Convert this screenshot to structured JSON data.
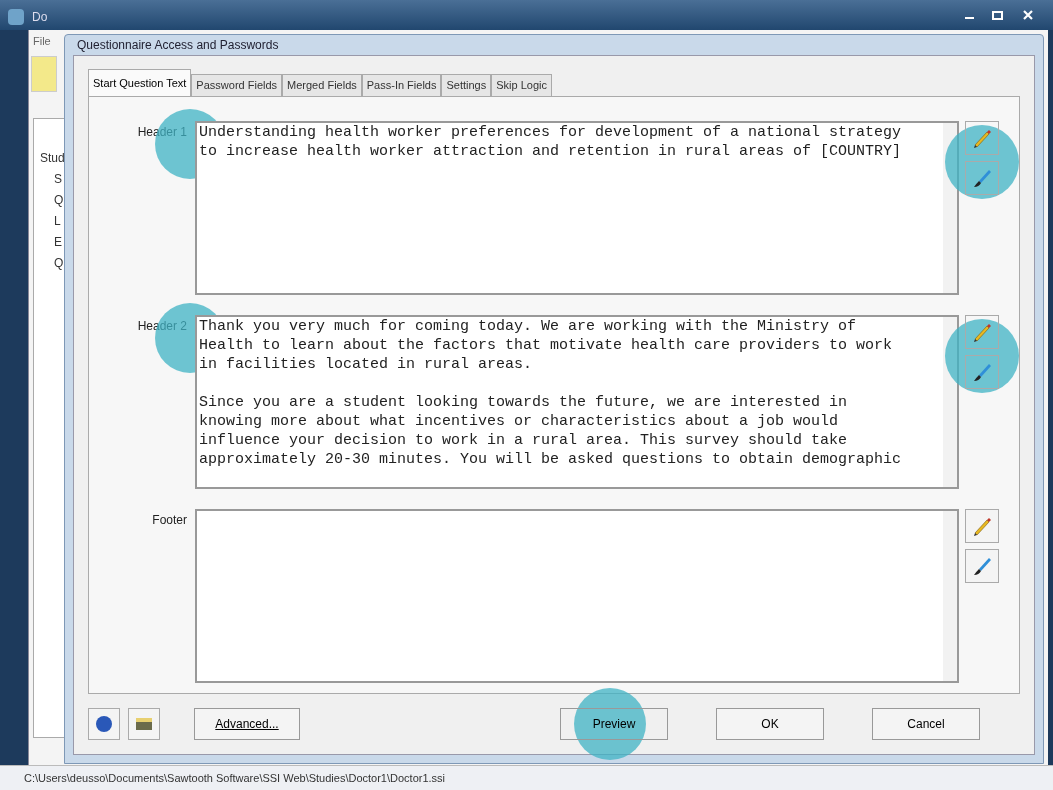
{
  "main_window": {
    "title": "Do",
    "menu": [
      "File"
    ],
    "tree": [
      "Stud",
      "S",
      "Q",
      "L",
      "E",
      "Q"
    ],
    "status_bar": "C:\\Users\\deusso\\Documents\\Sawtooth Software\\SSI Web\\Studies\\Doctor1\\Doctor1.ssi"
  },
  "dialog": {
    "title": "Questionnaire Access and Passwords",
    "tabs": [
      {
        "label": "Start Question Text",
        "selected": true
      },
      {
        "label": "Password Fields",
        "selected": false
      },
      {
        "label": "Merged Fields",
        "selected": false
      },
      {
        "label": "Pass-In Fields",
        "selected": false
      },
      {
        "label": "Settings",
        "selected": false
      },
      {
        "label": "Skip Logic",
        "selected": false
      }
    ],
    "fields": [
      {
        "label": "Header 1",
        "value": "Understanding health worker preferences for development of a national strategy\nto increase health worker attraction and retention in rural areas of [COUNTRY]",
        "highlighted": true
      },
      {
        "label": "Header 2",
        "value": "Thank you very much for coming today. We are working with the Ministry of\nHealth to learn about the factors that motivate health care providers to work\nin facilities located in rural areas.\n\nSince you are a student looking towards the future, we are interested in\nknowing more about what incentives or characteristics about a job would\ninfluence your decision to work in a rural area. This survey should take\napproximately 20-30 minutes. You will be asked questions to obtain demographic",
        "highlighted": true
      },
      {
        "label": "Footer",
        "highlighted": false
      }
    ],
    "buttons": [
      {
        "label": "Advanced...",
        "kind": "left",
        "highlighted": false
      },
      {
        "label": "Preview",
        "kind": "right",
        "highlighted": true
      },
      {
        "label": "OK",
        "kind": "right",
        "highlighted": false
      },
      {
        "label": "Cancel",
        "kind": "right",
        "highlighted": false
      }
    ]
  }
}
